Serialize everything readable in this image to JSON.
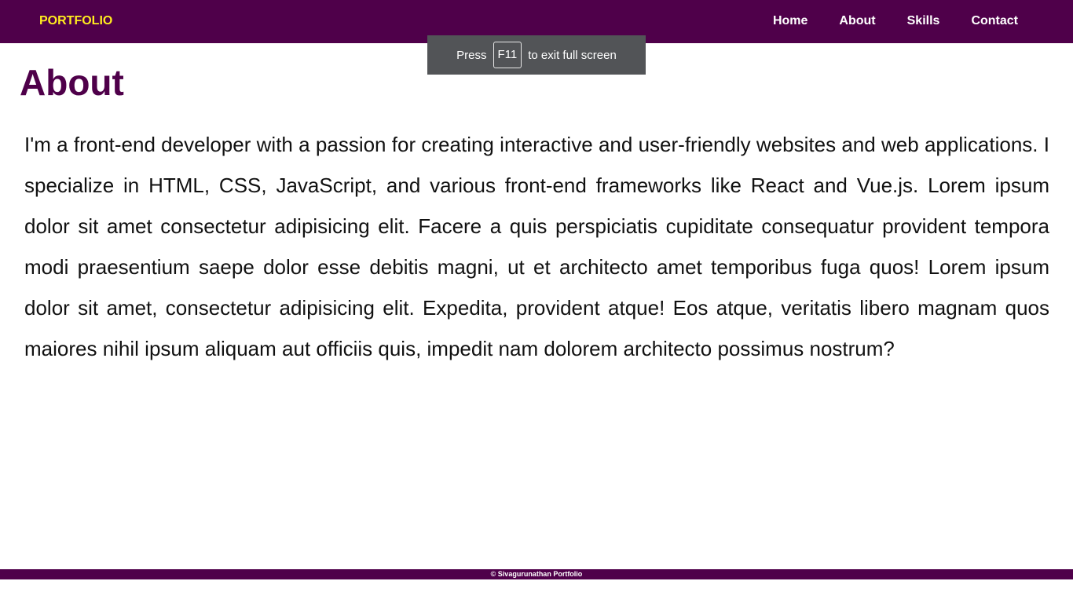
{
  "navbar": {
    "brand": "PORTFOLIO",
    "links": [
      "Home",
      "About",
      "Skills",
      "Contact"
    ]
  },
  "fullscreen_notice": {
    "prefix": "Press",
    "key": "F11",
    "suffix": "to exit full screen"
  },
  "about": {
    "title": "About",
    "body": "I'm a front-end developer with a passion for creating interactive and user-friendly websites and web applications. I specialize in HTML, CSS, JavaScript, and various front-end frameworks like React and Vue.js. Lorem ipsum dolor sit amet consectetur adipisicing elit. Facere a quis perspiciatis cupiditate consequatur provident tempora modi praesentium saepe dolor esse debitis magni, ut et architecto amet temporibus fuga quos! Lorem ipsum dolor sit amet, consectetur adipisicing elit. Expedita, provident atque! Eos atque, veritatis libero magnam quos maiores nihil ipsum aliquam aut officiis quis, impedit nam dolorem architecto possimus nostrum?"
  },
  "footer": {
    "text": "© Sivagurunathan Portfolio"
  },
  "colors": {
    "primary": "#4f004a",
    "brand": "#ffec1f",
    "toast": "#525457"
  }
}
